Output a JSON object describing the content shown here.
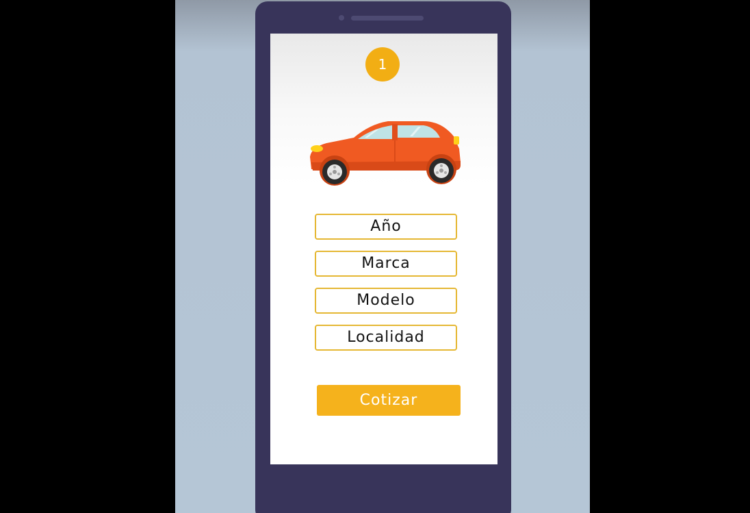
{
  "step": {
    "number": "1"
  },
  "form": {
    "fields": [
      {
        "label": "Año"
      },
      {
        "label": "Marca"
      },
      {
        "label": "Modelo"
      },
      {
        "label": "Localidad"
      }
    ],
    "submit_label": "Cotizar"
  },
  "illustration": {
    "icon": "car-icon",
    "body_color": "#f05a22"
  },
  "colors": {
    "accent": "#f5b21c",
    "field_border": "#e5b732",
    "phone_frame": "#38345a",
    "background": "#b5c6d6"
  }
}
